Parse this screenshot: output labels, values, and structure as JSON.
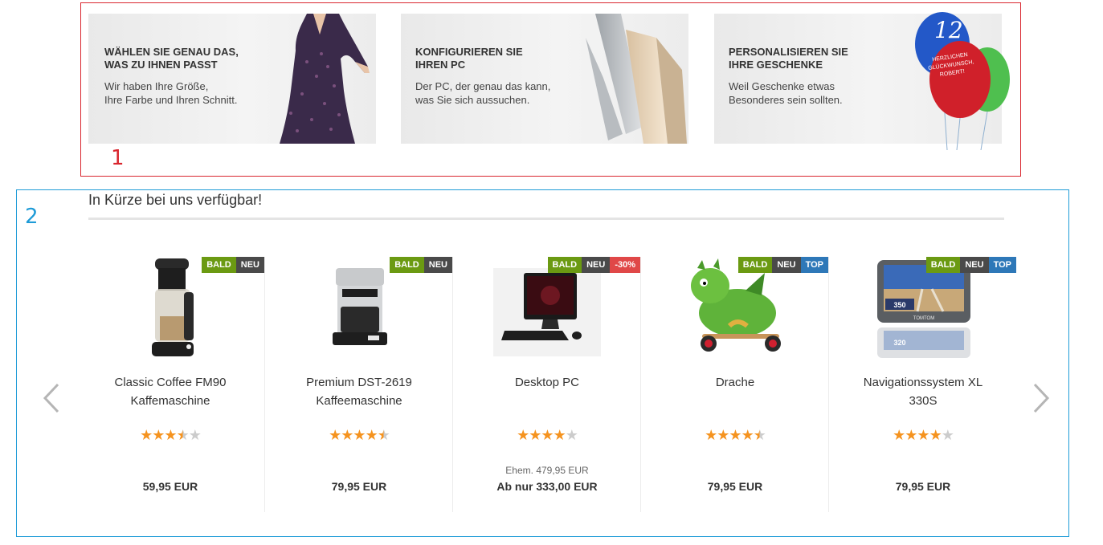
{
  "annotations": {
    "label_1": "1",
    "label_2": "2"
  },
  "banners": [
    {
      "title_line1": "WÄHLEN SIE GENAU DAS,",
      "title_line2": "WAS ZU IHNEN PASST",
      "text_line1": "Wir haben Ihre Größe,",
      "text_line2": "Ihre Farbe und Ihren Schnitt."
    },
    {
      "title_line1": "KONFIGURIEREN SIE",
      "title_line2": "IHREN PC",
      "text_line1": "Der PC, der genau das kann,",
      "text_line2": "was Sie sich aussuchen."
    },
    {
      "title_line1": "PERSONALISIEREN SIE",
      "title_line2": "IHRE GESCHENKE",
      "text_line1": "Weil Geschenke etwas",
      "text_line2": "Besonderes sein sollten.",
      "balloon_number": "12",
      "balloon_text_1": "HERZLICHEN",
      "balloon_text_2": "GLÜCKWUNSCH,",
      "balloon_text_3": "ROBERT!"
    }
  ],
  "section": {
    "title": "In Kürze bei uns verfügbar!"
  },
  "colors": {
    "accent_red": "#d9262e",
    "accent_blue": "#1e9bd7",
    "badge_bald": "#6b9a12",
    "badge_neu": "#4a4a4a",
    "badge_top": "#2e78b8",
    "badge_sale": "#e04848",
    "star": "#f5931f"
  },
  "products": [
    {
      "name_line1": "Classic Coffee FM90",
      "name_line2": "Kaffemaschine",
      "badges": [
        "BALD",
        "NEU"
      ],
      "rating": 3.5,
      "old_price": "",
      "price": "59,95 EUR",
      "icon": "coffee-machine-icon"
    },
    {
      "name_line1": "Premium DST-2619",
      "name_line2": "Kaffeemaschine",
      "badges": [
        "BALD",
        "NEU"
      ],
      "rating": 4.5,
      "old_price": "",
      "price": "79,95 EUR",
      "icon": "coffee-maker-icon"
    },
    {
      "name_line1": "Desktop PC",
      "name_line2": "",
      "badges": [
        "BALD",
        "NEU",
        "-30%"
      ],
      "rating": 4,
      "old_price": "Ehem. 479,95 EUR",
      "price": "Ab nur 333,00 EUR",
      "icon": "desktop-pc-icon"
    },
    {
      "name_line1": "Drache",
      "name_line2": "",
      "badges": [
        "BALD",
        "NEU",
        "TOP"
      ],
      "rating": 4.5,
      "old_price": "",
      "price": "79,95 EUR",
      "icon": "dragon-toy-icon"
    },
    {
      "name_line1": "Navigationssystem XL",
      "name_line2": "330S",
      "badges": [
        "BALD",
        "NEU",
        "TOP"
      ],
      "rating": 4,
      "old_price": "",
      "price": "79,95 EUR",
      "icon": "navigation-device-icon",
      "screen_speed": "350",
      "screen_distance": "320",
      "brand": "TOMTOM"
    }
  ]
}
